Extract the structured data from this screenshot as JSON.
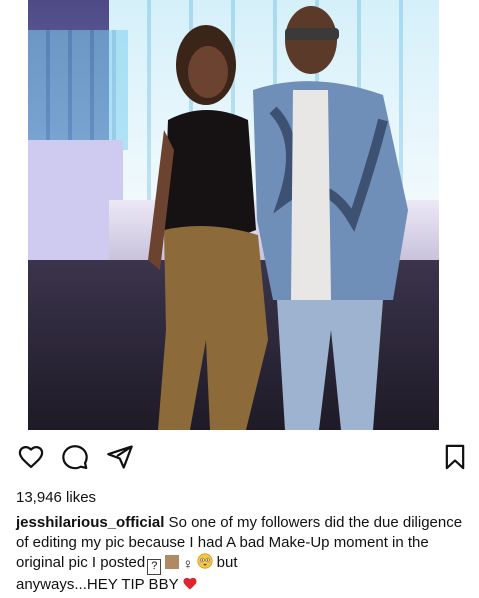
{
  "post": {
    "likes_text": "13,946 likes",
    "username": "jesshilarious_official",
    "caption_text": " So one of my followers did the due diligence of editing my pic because I had A bad Make-Up moment in the original pic I posted",
    "caption_glyph": "?",
    "caption_female_sign": "♀",
    "caption_but": " but",
    "caption_tail": "anyways...HEY TIP BBY"
  },
  "icons": {
    "like": "heart-outline-icon",
    "comment": "comment-bubble-icon",
    "share": "paper-plane-icon",
    "save": "bookmark-icon",
    "skin_tone": "skin-tone-swatch-icon",
    "flushed_face": "flushed-face-emoji-icon",
    "red_heart": "red-heart-emoji-icon"
  },
  "colors": {
    "text": "#111111",
    "heart_emoji": "#e0242f",
    "skin_tone": "#b08a63"
  }
}
